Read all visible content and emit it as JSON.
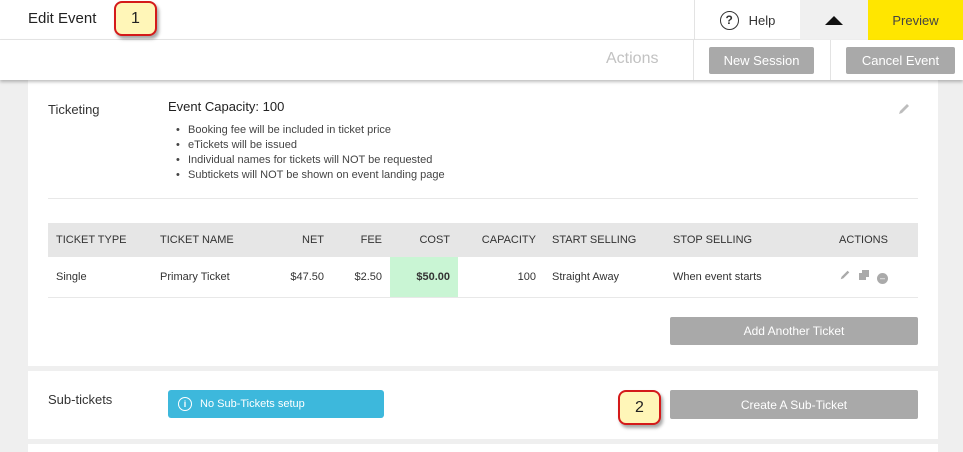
{
  "header": {
    "title": "Edit Event",
    "help_label": "Help",
    "preview_label": "Preview"
  },
  "actions_bar": {
    "label": "Actions",
    "new_session_label": "New Session",
    "cancel_event_label": "Cancel Event"
  },
  "ticketing": {
    "section_label": "Ticketing",
    "capacity_text": "Event Capacity: 100",
    "notes": [
      "Booking fee will be included in ticket price",
      "eTickets will be issued",
      "Individual names for tickets will NOT be requested",
      "Subtickets will NOT be shown on event landing page"
    ],
    "table": {
      "headers": [
        "TICKET TYPE",
        "TICKET NAME",
        "NET",
        "FEE",
        "COST",
        "CAPACITY",
        "START SELLING",
        "STOP SELLING",
        "ACTIONS"
      ],
      "rows": [
        {
          "type": "Single",
          "name": "Primary Ticket",
          "net": "$47.50",
          "fee": "$2.50",
          "cost": "$50.00",
          "capacity": "100",
          "start_selling": "Straight Away",
          "stop_selling": "When event starts"
        }
      ]
    },
    "add_ticket_label": "Add Another Ticket"
  },
  "sub_tickets": {
    "section_label": "Sub-tickets",
    "info_text": "No Sub-Tickets setup",
    "create_label": "Create A Sub-Ticket"
  },
  "callouts": [
    "1",
    "2"
  ],
  "colors": {
    "preview_bg": "#ffe600",
    "button_grey": "#a9a9a9",
    "cost_highlight": "#c9f5d4",
    "info_badge": "#3db8dc",
    "callout_border": "#d41a1a",
    "callout_fill": "#fff6b8"
  },
  "icons": {
    "help": "question-circle-icon",
    "collapse": "triangle-up-icon",
    "edit": "pencil-icon",
    "row_edit": "pencil-icon",
    "row_copy": "copy-icon",
    "row_remove": "minus-circle-icon",
    "info": "info-circle-icon"
  }
}
